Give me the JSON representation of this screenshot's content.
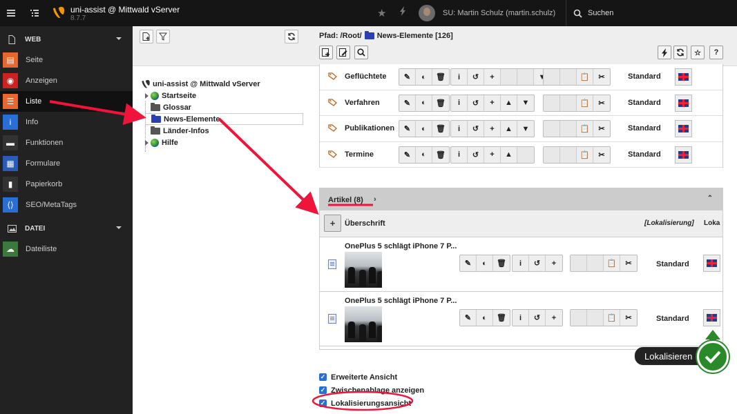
{
  "topbar": {
    "site_name": "uni-assist @ Mittwald vServer",
    "version": "8.7.7",
    "user": "SU: Martin Schulz (martin.schulz)",
    "search": "Suchen"
  },
  "modules": {
    "web_label": "WEB",
    "web_items": [
      {
        "label": "Seite",
        "color": "#e8672e",
        "icon": "page-icon"
      },
      {
        "label": "Anzeigen",
        "color": "#cc2222",
        "icon": "eye-icon"
      },
      {
        "label": "Liste",
        "color": "#e8672e",
        "icon": "list-icon"
      },
      {
        "label": "Info",
        "color": "#2a6fd6",
        "icon": "info-icon"
      },
      {
        "label": "Funktionen",
        "color": "#333333",
        "icon": "briefcase-icon"
      },
      {
        "label": "Formulare",
        "color": "#2a5bb8",
        "icon": "form-icon"
      },
      {
        "label": "Papierkorb",
        "color": "#333333",
        "icon": "trash-icon"
      },
      {
        "label": "SEO/MetaTags",
        "color": "#2a6fd6",
        "icon": "code-icon"
      }
    ],
    "file_label": "DATEI",
    "file_items": [
      {
        "label": "Dateiliste",
        "color": "#3a7a3a",
        "icon": "cloud-icon"
      }
    ]
  },
  "tree": {
    "root": "uni-assist @ Mittwald vServer",
    "nodes": [
      "Startseite",
      "Glossar",
      "News-Elemente",
      "Länder-Infos",
      "Hilfe"
    ]
  },
  "header": {
    "path_prefix": "Pfad: /Root/",
    "path_current": "News-Elemente [126]"
  },
  "categories": {
    "rows": [
      "Geflüchtete",
      "Verfahren",
      "Publikationen",
      "Termine"
    ],
    "language": "Standard"
  },
  "artikel": {
    "title": "Artikel (8)",
    "column_title": "Überschrift",
    "column_localization": "[Lokalisierung]",
    "column_loka": "Loka",
    "rows": [
      {
        "title": "OnePlus 5 schlägt iPhone 7 P...",
        "language": "Standard"
      },
      {
        "title": "OnePlus 5 schlägt iPhone 7 P...",
        "language": "Standard"
      }
    ]
  },
  "options": [
    "Erweiterte Ansicht",
    "Zwischenablage anzeigen",
    "Lokalisierungsansicht"
  ],
  "overlay": {
    "tooltip": "Lokalisieren",
    "arrow_color": "#f0133a",
    "check_color": "#2a8a2a"
  }
}
